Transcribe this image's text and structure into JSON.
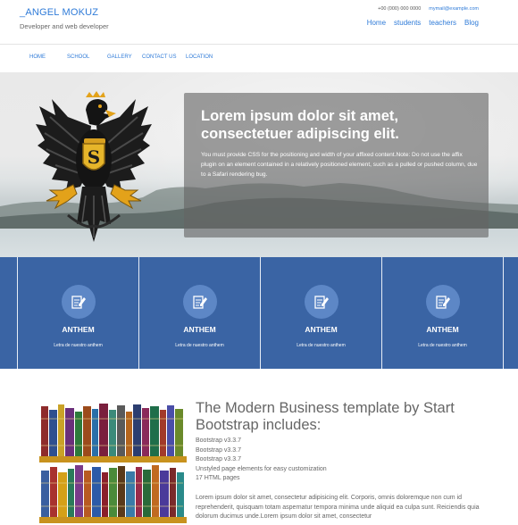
{
  "header": {
    "brand": "_ANGEL MOKUZ",
    "tagline": "Developer and web developer",
    "phone": "+00 (000) 000 0000",
    "email": "mymail@example.com",
    "nav": [
      "Home",
      "students",
      "teachers",
      "Blog"
    ]
  },
  "subnav": [
    "HOME",
    "SCHOOL",
    "GALLERY",
    "CONTACT US",
    "LOCATION"
  ],
  "hero": {
    "title": "Lorem ipsum dolor sit amet, consectetuer adipiscing elit.",
    "text": "You must provide CSS for the positioning and width of your affixed content.Note: Do not use the affix plugin on an element contained in a relatively positioned element, such as a pulled or pushed column, due to a Safari rendering bug."
  },
  "features": [
    {
      "title": "ANTHEM",
      "subtitle": "Letra de nuestro anthem",
      "icon": "edit-icon"
    },
    {
      "title": "ANTHEM",
      "subtitle": "Letra de nuestro anthem",
      "icon": "edit-icon"
    },
    {
      "title": "ANTHEM",
      "subtitle": "Letra de nuestro anthem",
      "icon": "edit-icon"
    },
    {
      "title": "ANTHEM",
      "subtitle": "Letra de nuestro anthem",
      "icon": "edit-icon"
    }
  ],
  "content": {
    "heading": "The Modern Business template by Start Bootstrap includes:",
    "bullets": [
      "Bootstrap v3.3.7",
      "Bootstrap v3.3.7",
      "Bootstrap v3.3.7",
      "Unstyled page elements for easy customization",
      "17 HTML pages"
    ],
    "paragraph": "Lorem ipsum dolor sit amet, consectetur adipisicing elit. Corporis, omnis doloremque non cum id reprehenderit, quisquam totam aspernatur tempora minima unde aliquid ea culpa sunt. Reiciendis quia dolorum ducimus unde.Lorem ipsum dolor sit amet, consectetur"
  },
  "colors": {
    "accent": "#2f7bd8",
    "band": "#3a64a4",
    "icon_circle": "#5d87c6"
  }
}
